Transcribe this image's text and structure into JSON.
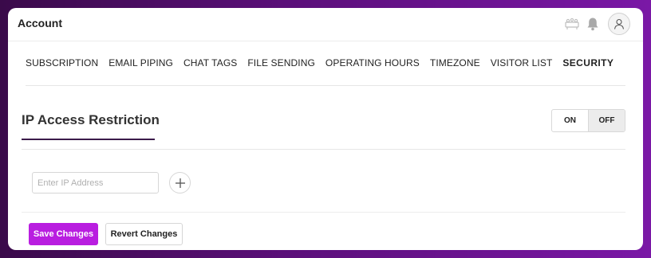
{
  "header": {
    "title": "Account",
    "icons": [
      "team-icon",
      "bell-icon",
      "user-avatar-icon"
    ]
  },
  "tabs": [
    {
      "label": "SUBSCRIPTION",
      "active": false
    },
    {
      "label": "EMAIL PIPING",
      "active": false
    },
    {
      "label": "CHAT TAGS",
      "active": false
    },
    {
      "label": "FILE SENDING",
      "active": false
    },
    {
      "label": "OPERATING HOURS",
      "active": false
    },
    {
      "label": "TIMEZONE",
      "active": false
    },
    {
      "label": "VISITOR LIST",
      "active": false
    },
    {
      "label": "SECURITY",
      "active": true
    }
  ],
  "section": {
    "title": "IP Access Restriction",
    "toggle": {
      "on_label": "ON",
      "off_label": "OFF",
      "selected": "OFF"
    }
  },
  "ip_input": {
    "placeholder": "Enter IP Address",
    "value": ""
  },
  "add_icon": "plus-icon",
  "actions": {
    "save_label": "Save Changes",
    "revert_label": "Revert Changes"
  },
  "colors": {
    "accent": "#b91ee0",
    "underline": "#3b1a4a",
    "background_gradient_end": "#7a18a6"
  }
}
